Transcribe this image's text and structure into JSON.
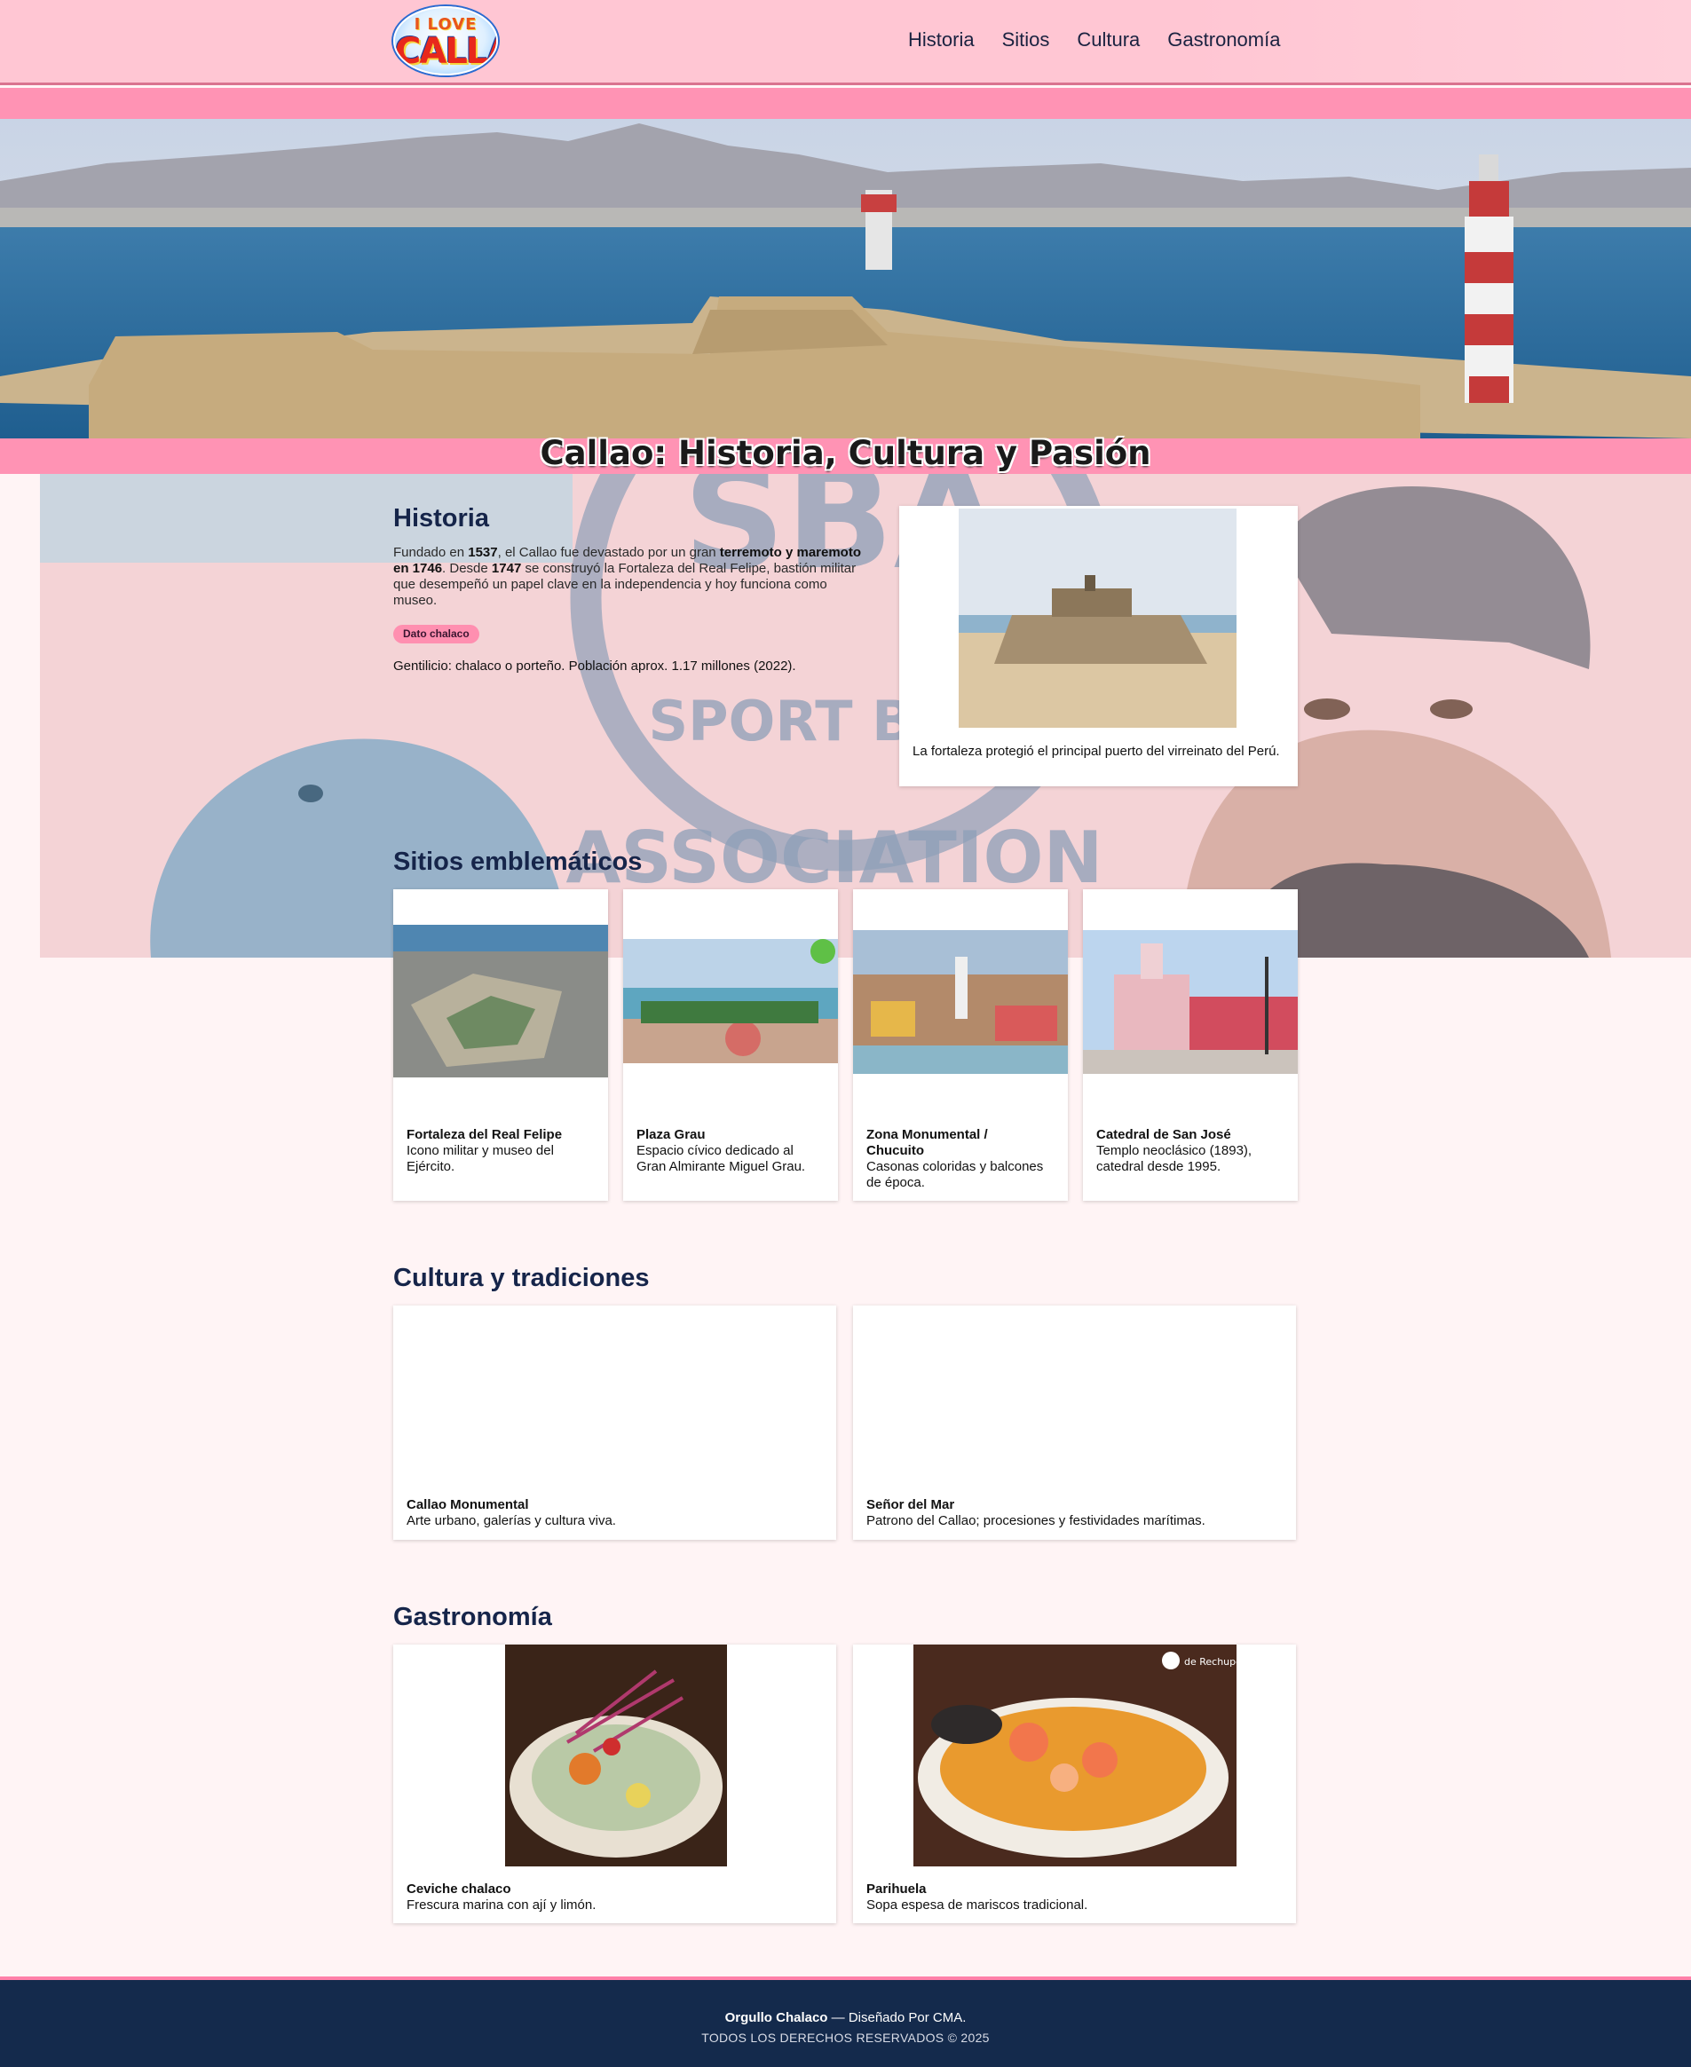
{
  "header": {
    "logo_line1": "I LOVE",
    "logo_line2": "CALLAO",
    "nav": [
      "Historia",
      "Sitios",
      "Cultura",
      "Gastronomía"
    ]
  },
  "hero": {
    "title": "Callao: Historia, Cultura y Pasión"
  },
  "background_art": {
    "text": "ASSOCIATION",
    "emblem": "SBA",
    "emblem_ring": "SPORT BOYS"
  },
  "historia": {
    "title": "Historia",
    "p_a": "Fundado en ",
    "year1": "1537",
    "p_b": ", el Callao fue devastado por un gran ",
    "event": "terremoto y maremoto en 1746",
    "p_c": ". Desde ",
    "year2": "1747",
    "p_d": " se construyó la Fortaleza del Real Felipe, bastión militar que desempeñó un papel clave en la independencia y hoy funciona como museo.",
    "badge": "Dato chalaco",
    "gentilicio": "Gentilicio: chalaco o porteño. Población aprox. 1.17 millones (2022).",
    "figure_caption": "La fortaleza protegió el principal puerto del virreinato del Perú."
  },
  "sitios": {
    "title": "Sitios emblemáticos",
    "items": [
      {
        "title": "Fortaleza del Real Felipe",
        "desc": "Icono militar y museo del Ejército."
      },
      {
        "title": "Plaza Grau",
        "desc": "Espacio cívico dedicado al Gran Almirante Miguel Grau."
      },
      {
        "title": "Zona Monumental / Chucuito",
        "desc": "Casonas coloridas y balcones de época."
      },
      {
        "title": "Catedral de San José",
        "desc": "Templo neoclásico (1893), catedral desde 1995."
      }
    ]
  },
  "cultura": {
    "title": "Cultura y tradiciones",
    "items": [
      {
        "title": "Callao Monumental",
        "desc": "Arte urbano, galerías y cultura viva."
      },
      {
        "title": "Señor del Mar",
        "desc": "Patrono del Callao; procesiones y festividades marítimas."
      }
    ]
  },
  "gastronomia": {
    "title": "Gastronomía",
    "items": [
      {
        "title": "Ceviche chalaco",
        "desc": "Frescura marina con ají y limón."
      },
      {
        "title": "Parihuela",
        "desc": "Sopa espesa de mariscos tradicional."
      }
    ],
    "watermark": "de Rechupete"
  },
  "footer": {
    "brand": "Orgullo Chalaco",
    "credit": " — Diseñado Por CMA.",
    "rights": "TODOS LOS DERECHOS RESERVADOS © 2025"
  }
}
